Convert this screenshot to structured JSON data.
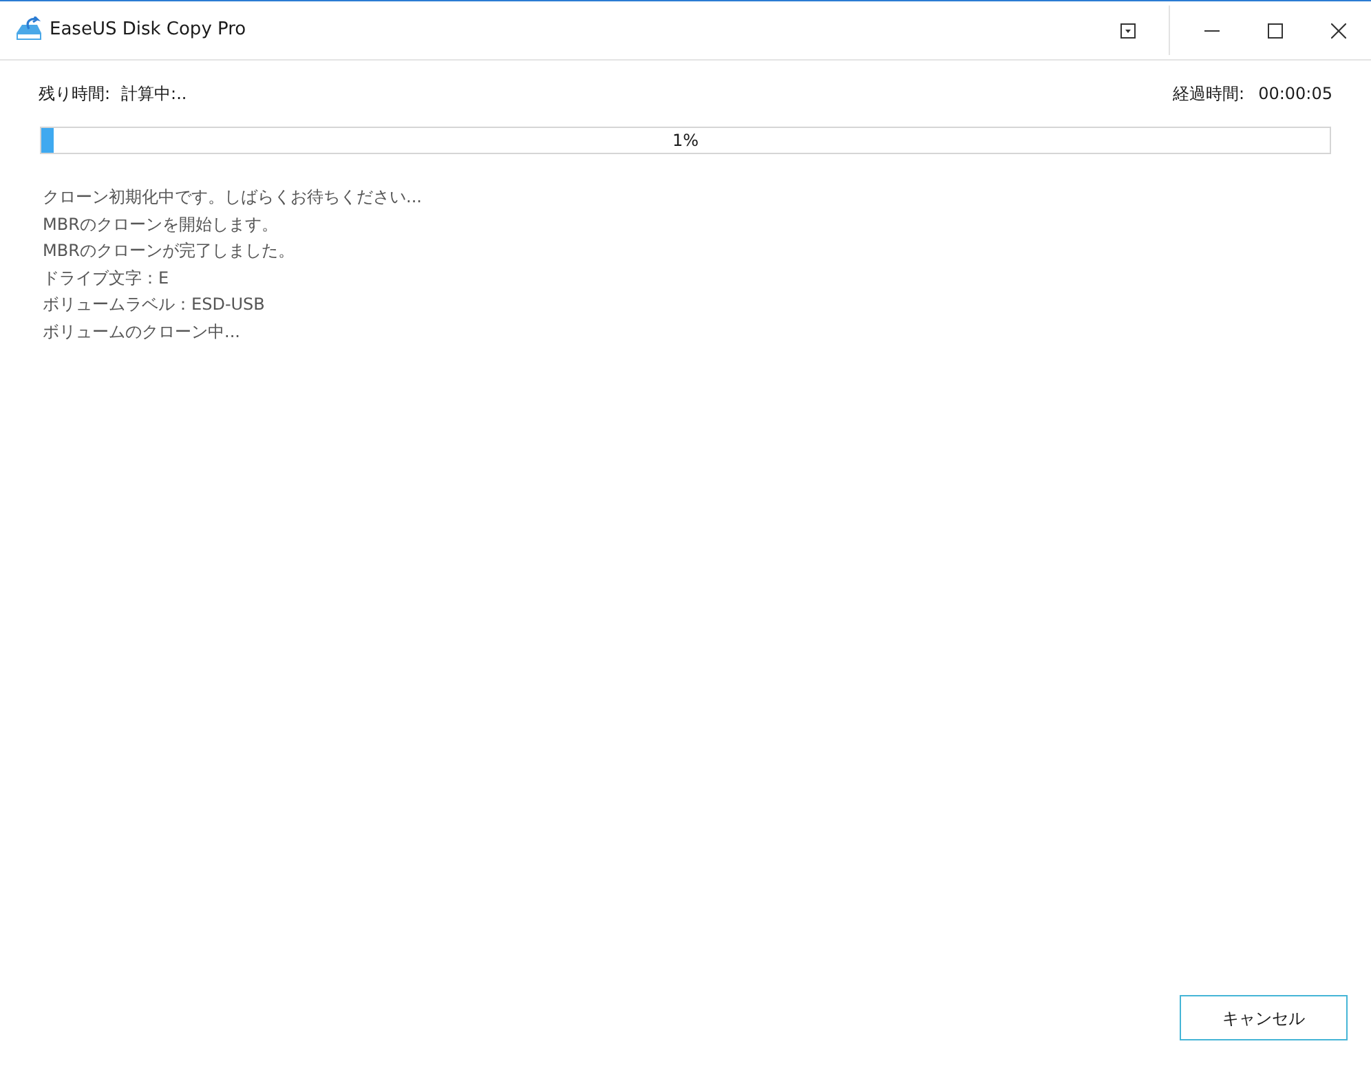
{
  "window": {
    "title": "EaseUS Disk Copy Pro"
  },
  "remaining": {
    "label": "残り時間:",
    "value": "計算中:.."
  },
  "elapsed": {
    "label": "経過時間:",
    "value": "00:00:05"
  },
  "progress": {
    "level": 0.01,
    "reading": "1%"
  },
  "log": [
    "クローン初期化中です。しばらくお待ちください...",
    "MBRのクローンを開始します。",
    "MBRのクローンが完了しました。",
    "ドライブ文字：E",
    "ボリュームラベル：ESD-USB",
    "ボリュームのクローン中..."
  ],
  "buttons": [
    "キャンセル"
  ]
}
